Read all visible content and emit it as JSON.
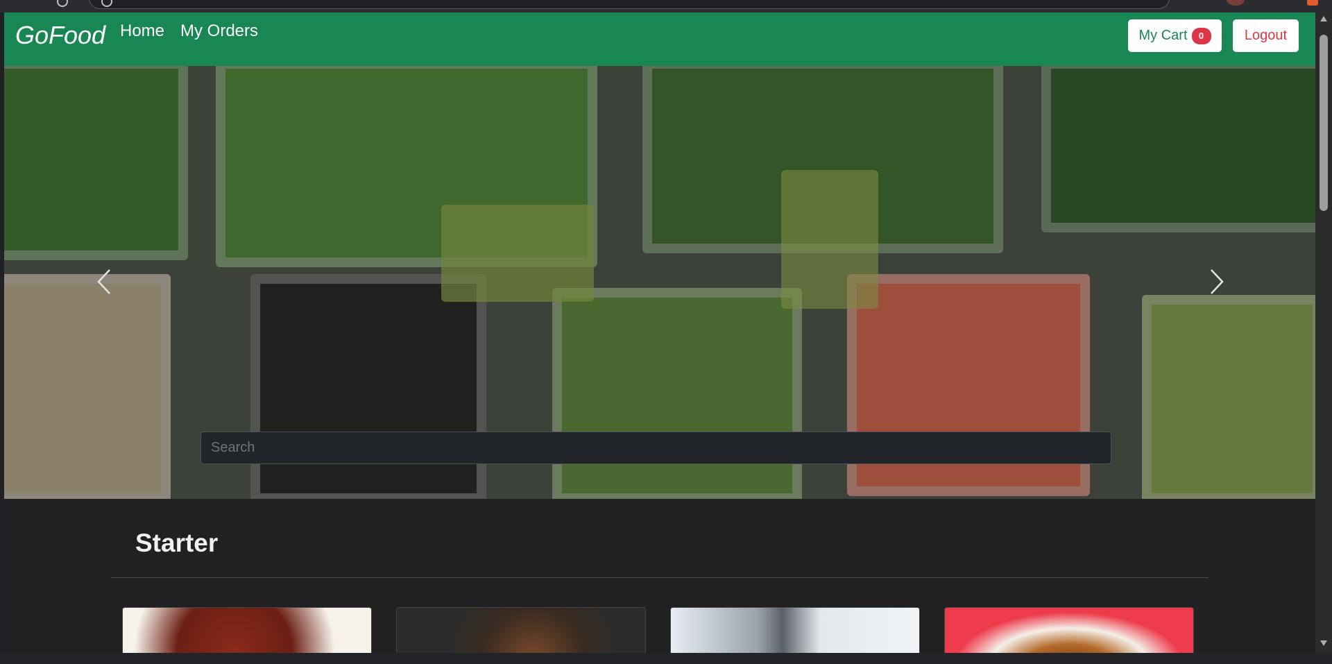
{
  "navbar": {
    "brand": "GoFood",
    "links": [
      "Home",
      "My Orders"
    ],
    "cart_label": "My Cart",
    "cart_count": "0",
    "logout_label": "Logout"
  },
  "hero": {
    "search_placeholder": "Search"
  },
  "section": {
    "title": "Starter"
  },
  "colors": {
    "navbar_bg": "#198754",
    "cart_text": "#198754",
    "badge_bg": "#dc3545",
    "logout_text": "#dc3545",
    "page_bg": "#212121"
  },
  "icons": {
    "prev": "chevron-left-icon",
    "next": "chevron-right-icon"
  }
}
